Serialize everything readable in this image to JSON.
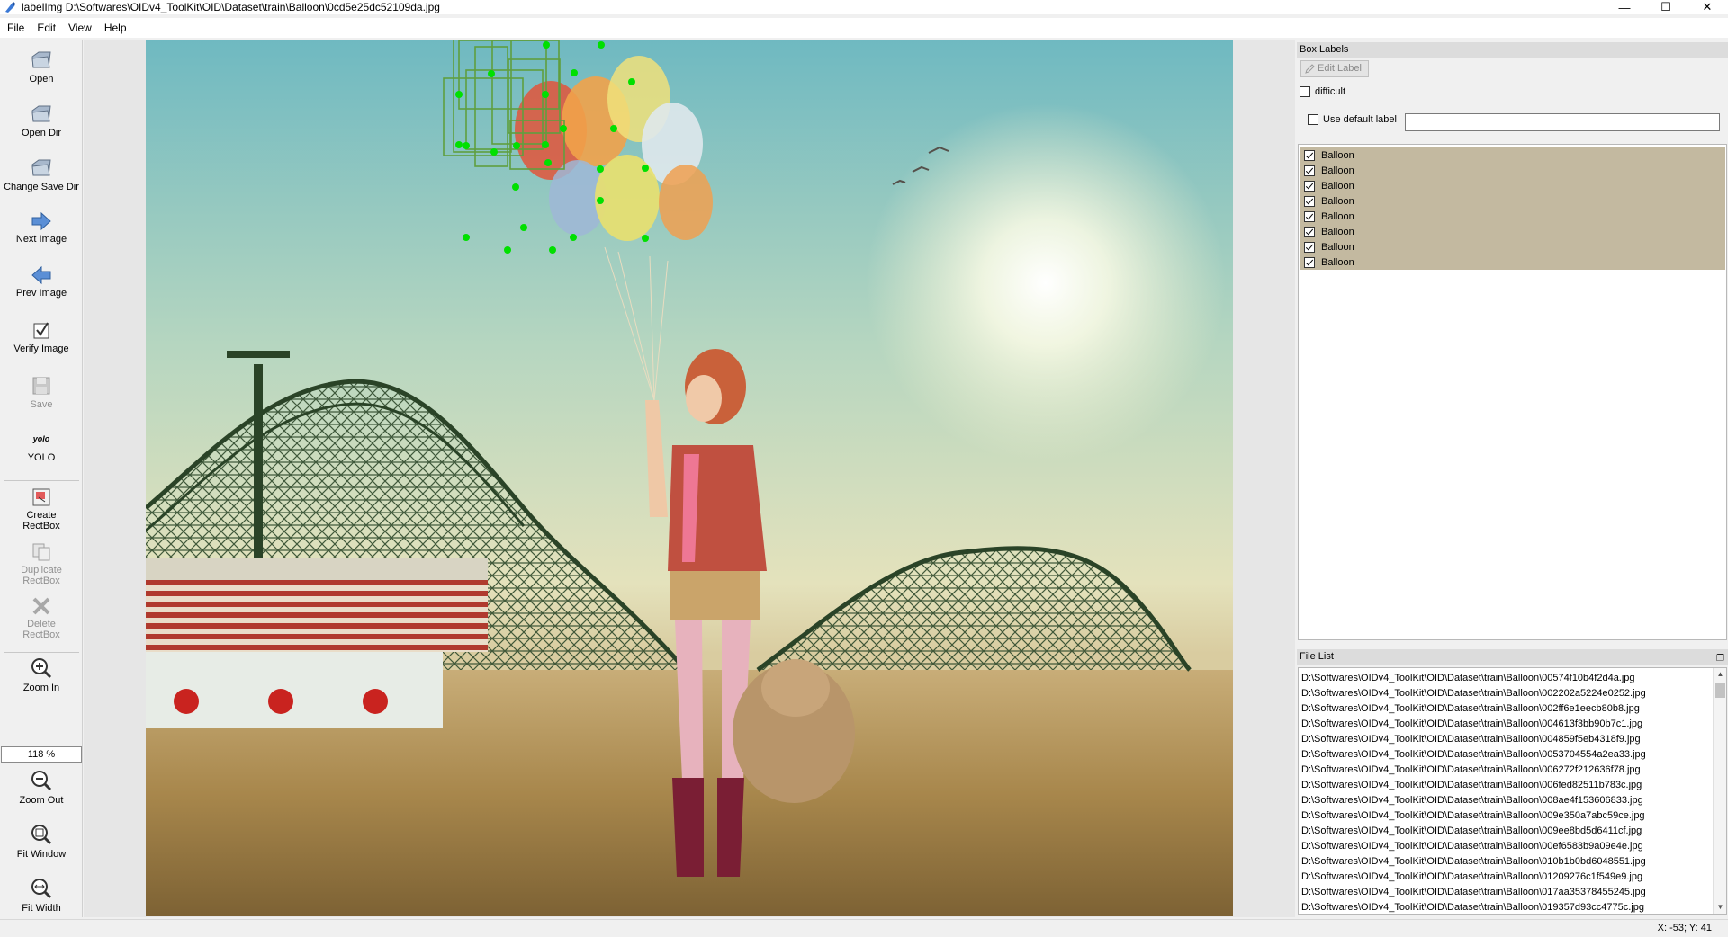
{
  "window": {
    "title": "labelImg D:\\Softwares\\OIDv4_ToolKit\\OID\\Dataset\\train\\Balloon\\0cd5e25dc52109da.jpg",
    "controls": [
      "—",
      "☐",
      "✕"
    ]
  },
  "menu": [
    "File",
    "Edit",
    "View",
    "Help"
  ],
  "toolbar": {
    "open": "Open",
    "open_dir": "Open Dir",
    "change_save_dir": "Change Save Dir",
    "next_image": "Next Image",
    "prev_image": "Prev Image",
    "verify_image": "Verify Image",
    "save": "Save",
    "yolo_icon_text": "yolo",
    "yolo": "YOLO",
    "create_rectbox_1": "Create",
    "create_rectbox_2": "RectBox",
    "duplicate_rectbox_1": "Duplicate",
    "duplicate_rectbox_2": "RectBox",
    "delete_rectbox_1": "Delete",
    "delete_rectbox_2": "RectBox",
    "zoom_in": "Zoom In",
    "zoom_level": "118 %",
    "zoom_out": "Zoom Out",
    "fit_window": "Fit Window",
    "fit_width": "Fit Width"
  },
  "box_labels_panel": {
    "title": "Box Labels",
    "edit_label": "Edit Label",
    "difficult": "difficult",
    "use_default_label": "Use default label",
    "default_label_value": "",
    "labels": [
      "Balloon",
      "Balloon",
      "Balloon",
      "Balloon",
      "Balloon",
      "Balloon",
      "Balloon",
      "Balloon"
    ]
  },
  "file_list_panel": {
    "title": "File List",
    "files": [
      "D:\\Softwares\\OIDv4_ToolKit\\OID\\Dataset\\train\\Balloon\\00574f10b4f2d4a.jpg",
      "D:\\Softwares\\OIDv4_ToolKit\\OID\\Dataset\\train\\Balloon\\002202a5224e0252.jpg",
      "D:\\Softwares\\OIDv4_ToolKit\\OID\\Dataset\\train\\Balloon\\002ff6e1eecb80b8.jpg",
      "D:\\Softwares\\OIDv4_ToolKit\\OID\\Dataset\\train\\Balloon\\004613f3bb90b7c1.jpg",
      "D:\\Softwares\\OIDv4_ToolKit\\OID\\Dataset\\train\\Balloon\\004859f5eb4318f9.jpg",
      "D:\\Softwares\\OIDv4_ToolKit\\OID\\Dataset\\train\\Balloon\\0053704554a2ea33.jpg",
      "D:\\Softwares\\OIDv4_ToolKit\\OID\\Dataset\\train\\Balloon\\006272f212636f78.jpg",
      "D:\\Softwares\\OIDv4_ToolKit\\OID\\Dataset\\train\\Balloon\\006fed82511b783c.jpg",
      "D:\\Softwares\\OIDv4_ToolKit\\OID\\Dataset\\train\\Balloon\\008ae4f153606833.jpg",
      "D:\\Softwares\\OIDv4_ToolKit\\OID\\Dataset\\train\\Balloon\\009e350a7abc59ce.jpg",
      "D:\\Softwares\\OIDv4_ToolKit\\OID\\Dataset\\train\\Balloon\\009ee8bd5d6411cf.jpg",
      "D:\\Softwares\\OIDv4_ToolKit\\OID\\Dataset\\train\\Balloon\\00ef6583b9a09e4e.jpg",
      "D:\\Softwares\\OIDv4_ToolKit\\OID\\Dataset\\train\\Balloon\\010b1b0bd6048551.jpg",
      "D:\\Softwares\\OIDv4_ToolKit\\OID\\Dataset\\train\\Balloon\\01209276c1f549e9.jpg",
      "D:\\Softwares\\OIDv4_ToolKit\\OID\\Dataset\\train\\Balloon\\017aa35378455245.jpg",
      "D:\\Softwares\\OIDv4_ToolKit\\OID\\Dataset\\train\\Balloon\\019357d93cc4775c.jpg"
    ]
  },
  "status": {
    "coords": "X: -53; Y: 41"
  },
  "colors": {
    "label_row": "#c3b9a0",
    "bbox_handle": "#00e000",
    "bbox_edge": "#5f9f3f"
  }
}
